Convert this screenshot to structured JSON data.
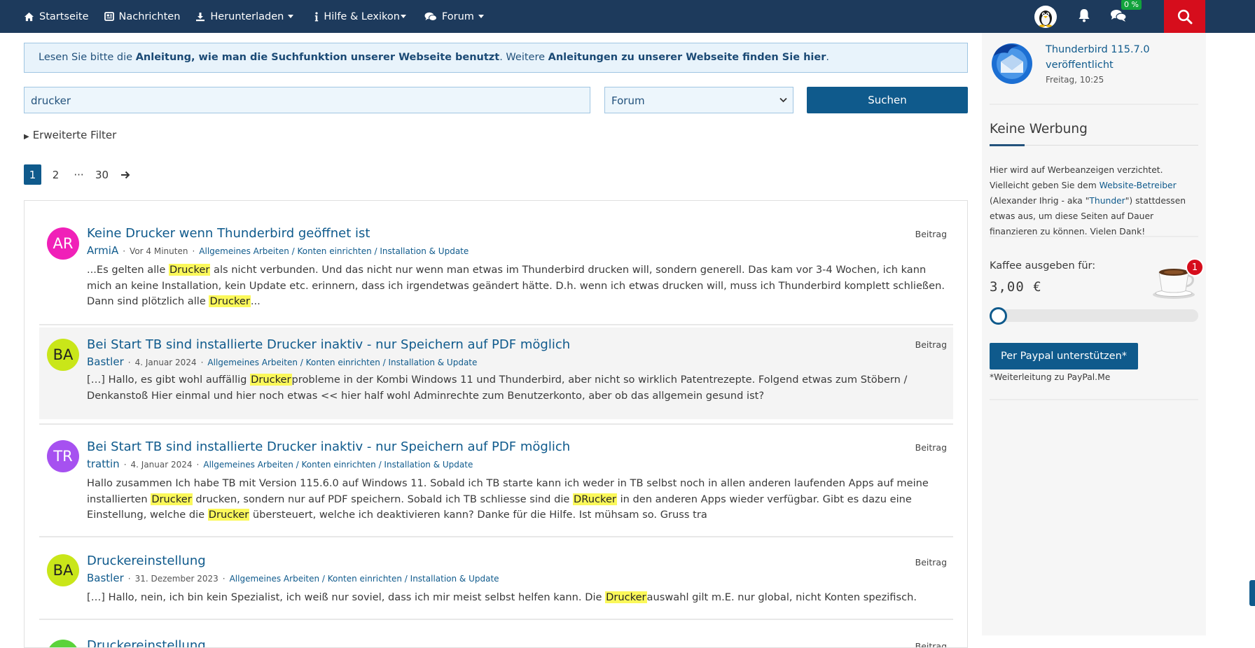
{
  "nav": {
    "items": [
      {
        "label": "Startseite",
        "icon": "home-icon",
        "dropdown": false
      },
      {
        "label": "Nachrichten",
        "icon": "newspaper-icon",
        "dropdown": false
      },
      {
        "label": "Herunterladen",
        "icon": "download-icon",
        "dropdown": true
      },
      {
        "label": "Hilfe & Lexikon",
        "icon": "info-icon",
        "dropdown": true
      },
      {
        "label": "Forum",
        "icon": "chat-bubbles-icon",
        "dropdown": true
      }
    ],
    "percent_badge": "0 %",
    "colors": {
      "bar": "#1d3a5c",
      "search": "#d60d1c",
      "badge": "#12a33c"
    }
  },
  "notice": {
    "prefix": "Lesen Sie bitte die ",
    "link1": "Anleitung, wie man die Suchfunktion unserer Webseite benutzt",
    "middle": ". Weitere ",
    "link2": "Anleitungen zu unserer Webseite finden Sie hier",
    "suffix": "."
  },
  "search": {
    "query": "drucker",
    "scope": "Forum",
    "submit_label": "Suchen",
    "filter_toggle": "Erweiterte Filter"
  },
  "pagination": {
    "pages": [
      "1",
      "2",
      "···",
      "30"
    ],
    "current": "1"
  },
  "results": [
    {
      "initials": "AR",
      "avatar_color": "#f020b8",
      "avatar_text_color": "#ffffff",
      "title": "Keine Drucker wenn Thunderbird geöffnet ist",
      "user": "ArmiA",
      "time": "Vor 4 Minuten",
      "category": "Allgemeines Arbeiten / Konten einrichten / Installation & Update",
      "type": "Beitrag",
      "snippet": [
        {
          "t": "...Es gelten alle "
        },
        {
          "t": "Drucker",
          "hl": true
        },
        {
          "t": " als nicht verbunden. Und das nicht nur wenn man etwas im Thunderbird drucken will, sondern generell. Das kam vor 3-4 Wochen, ich kann mich an keine Installation, kein Update etc. erinnern, dass ich irgendetwas geändert hätte. D.h. wenn ich etwas drucken will, muss ich Thunderbird komplett schließen. Dann sind plötzlich alle "
        },
        {
          "t": "Drucker",
          "hl": true
        },
        {
          "t": "..."
        }
      ]
    },
    {
      "initials": "BA",
      "avatar_color": "#c9e619",
      "avatar_text_color": "#222222",
      "title": "Bei Start TB sind installierte Drucker inaktiv - nur Speichern auf PDF möglich",
      "user": "Bastler",
      "time": "4. Januar 2024",
      "category": "Allgemeines Arbeiten / Konten einrichten / Installation & Update",
      "type": "Beitrag",
      "snippet": [
        {
          "t": "[…] Hallo, es gibt wohl auffällig "
        },
        {
          "t": "Drucker",
          "hl": true
        },
        {
          "t": "probleme in der Kombi Windows 11 und Thunderbird, aber nicht so wirklich Patentrezepte. Folgend etwas zum Stöbern / Denkanstoß Hier einmal und hier noch etwas << hier half wohl Adminrechte zum Benutzerkonto, aber ob das allgemein gesund ist?"
        }
      ]
    },
    {
      "initials": "TR",
      "avatar_color": "#a651f0",
      "avatar_text_color": "#ffffff",
      "title": "Bei Start TB sind installierte Drucker inaktiv - nur Speichern auf PDF möglich",
      "user": "trattin",
      "time": "4. Januar 2024",
      "category": "Allgemeines Arbeiten / Konten einrichten / Installation & Update",
      "type": "Beitrag",
      "snippet": [
        {
          "t": "Hallo zusammen Ich habe TB mit Version 115.6.0 auf Windows 11. Sobald ich TB starte kann ich weder in TB selbst noch in allen anderen laufenden Apps auf meine installierten "
        },
        {
          "t": "Drucker",
          "hl": true
        },
        {
          "t": " drucken, sondern nur auf PDF speichern. Sobald ich TB schliesse sind die "
        },
        {
          "t": "DRucker",
          "hl": true
        },
        {
          "t": " in den anderen Apps wieder verfügbar. Gibt es dazu eine Einstellung, welche die "
        },
        {
          "t": "Drucker",
          "hl": true
        },
        {
          "t": " übersteuert, welche ich deaktivieren kann? Danke für die Hilfe. Ist mühsam so. Gruss tra"
        }
      ]
    },
    {
      "initials": "BA",
      "avatar_color": "#c9e619",
      "avatar_text_color": "#222222",
      "title": "Druckereinstellung",
      "user": "Bastler",
      "time": "31. Dezember 2023",
      "category": "Allgemeines Arbeiten / Konten einrichten / Installation & Update",
      "type": "Beitrag",
      "snippet": [
        {
          "t": "[…] Hallo, nein, ich bin kein Spezialist, ich weiß nur soviel, dass ich mir meist selbst helfen kann. Die "
        },
        {
          "t": "Drucker",
          "hl": true
        },
        {
          "t": "auswahl gilt m.E. nur global, nicht Konten spezifisch."
        }
      ]
    },
    {
      "initials": "",
      "avatar_color": "#5bd33a",
      "avatar_text_color": "#222222",
      "title": "Druckereinstellung",
      "user": "",
      "time": "",
      "category": "",
      "type": "Beitrag",
      "snippet": []
    }
  ],
  "sidebar": {
    "news_title": "Thunderbird 115.7.0 veröffentlicht",
    "news_date": "Freitag, 10:25",
    "ad_heading": "Keine Werbung",
    "ad_text_1": "Hier wird auf Werbeanzeigen verzichtet. Vielleicht geben Sie dem ",
    "ad_link_1": "Website-Betreiber",
    "ad_text_2": " (Alexander Ihrig - aka \"",
    "ad_link_2": "Thunder",
    "ad_text_3": "\") stattdessen etwas aus, um diese Seiten auf Dauer finanzieren zu können. Vielen Dank!",
    "coffee_label": "Kaffee ausgeben für:",
    "coffee_amount": "3,00 €",
    "coffee_badge": "1",
    "coffee_slider_value": 0,
    "paypal_button": "Per Paypal unterstützen*",
    "paypal_note": "*Weiterleitung zu PayPal.Me"
  }
}
